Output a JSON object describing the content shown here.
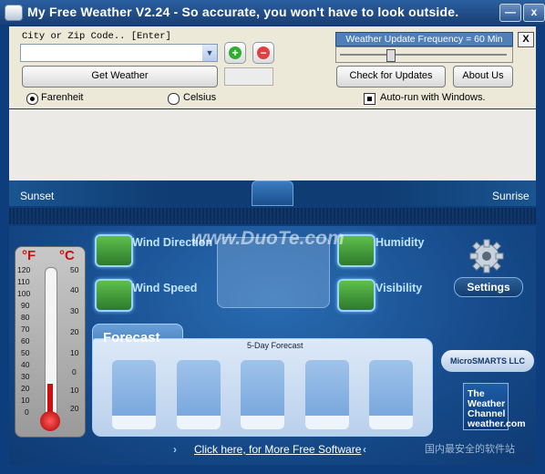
{
  "window": {
    "title": "My Free Weather V2.24 -  So accurate, you won't have to look outside.",
    "minimize": "—",
    "close": "x"
  },
  "controls": {
    "city_label": "City or Zip Code..  [Enter]",
    "city_value": "",
    "combo_arrow": "▼",
    "add_symbol": "+",
    "remove_symbol": "−",
    "get_weather": "Get Weather",
    "fahrenheit": "Farenheit",
    "celsius": "Celsius",
    "unit_selected": "Farenheit",
    "update_frequency": "Weather Update Frequency = 60 Min",
    "close_settings": "X",
    "check_updates": "Check for Updates",
    "about": "About Us",
    "autorun": "Auto-run with Windows.",
    "autorun_checked": true
  },
  "sun": {
    "sunset": "Sunset",
    "sunrise": "Sunrise"
  },
  "thermometer": {
    "f_label": "°F",
    "c_label": "°C",
    "f_ticks": [
      "120",
      "110",
      "100",
      "90",
      "80",
      "70",
      "60",
      "50",
      "40",
      "30",
      "20",
      "10",
      "0"
    ],
    "c_ticks": [
      "50",
      "40",
      "30",
      "20",
      "10",
      "0",
      "10",
      "20"
    ]
  },
  "metrics": {
    "wind_direction": "Wind Direction",
    "wind_speed": "Wind Speed",
    "humidity": "Humidity",
    "visibility": "Visibility"
  },
  "settings": {
    "label": "Settings"
  },
  "forecast": {
    "title": "Forecast",
    "subtitle": "5-Day Forecast"
  },
  "branding": {
    "microsmarts": "MicroSMARTS LLC",
    "weather_channel": "The Weather Channel weather.com"
  },
  "footer": {
    "link": "Click here, for More Free Software",
    "arrow_left": "›",
    "arrow_right": "‹"
  },
  "watermarks": {
    "duote": "www.DuoTe.com",
    "cn": "国内最安全的软件站"
  },
  "colors": {
    "frame": "#0d3d7d",
    "panel": "#ece9d8",
    "accent_text": "#bfe6ff",
    "mercury": "#cc1010"
  }
}
